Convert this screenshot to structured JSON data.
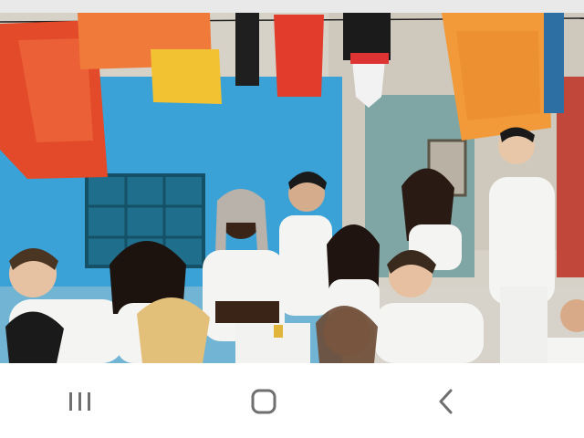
{
  "media": {
    "scene": "video-frame",
    "colors": {
      "wall": "#3aa2d6",
      "building": "#d7d2c7",
      "flag_red": "#e24a2a",
      "flag_orange": "#f29a3a",
      "flag_yellow": "#f2c232",
      "clothing": "#f4f4f2"
    }
  },
  "nav_bar": {
    "buttons": [
      {
        "id": "recents",
        "icon": "recents-icon"
      },
      {
        "id": "home",
        "icon": "home-icon"
      },
      {
        "id": "back",
        "icon": "back-icon"
      }
    ],
    "icon_color": "#6f6f6f"
  }
}
